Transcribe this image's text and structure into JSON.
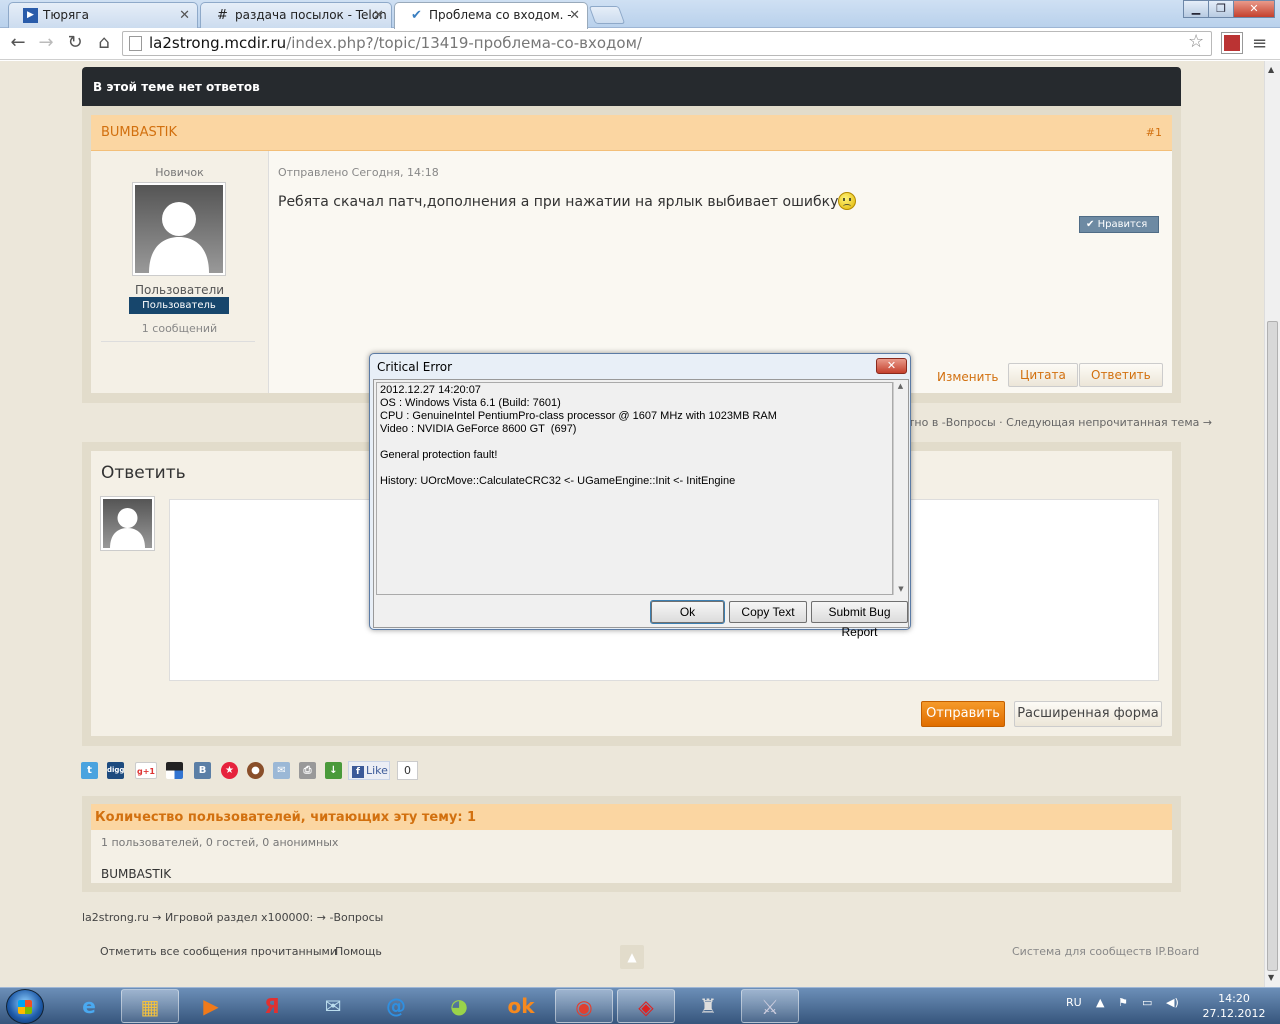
{
  "browser": {
    "tabs": [
      {
        "title": "Тюряга",
        "icon": "play-icon"
      },
      {
        "title": "раздача посылок - Telon",
        "icon": "hash-icon"
      },
      {
        "title": "Проблема со входом. - ",
        "icon": "check-icon"
      }
    ],
    "url_host": "la2strong.mcdir.ru",
    "url_path": "/index.php?/topic/13419-проблема-со-входом/"
  },
  "forum": {
    "no_replies": "В этой теме нет ответов",
    "post": {
      "author": "BUMBASTIK",
      "number": "#1",
      "rank": "Новичок",
      "group": "Пользователи",
      "group_badge": "Пользователь",
      "post_count": "1 сообщений",
      "posted": "Отправлено Сегодня, 14:18",
      "message": "Ребята скачал патч,дополнения а при нажатии на ярлык выбивает ошибку",
      "like": "Нравится",
      "edit": "Изменить",
      "quote": "Цитата",
      "reply": "Ответить"
    },
    "topic_nav": "тно в -Вопросы · Следующая непрочитанная тема →",
    "reply_box": {
      "title": "Ответить",
      "send": "Отправить",
      "advanced": "Расширенная форма"
    },
    "share": {
      "fb_like": "Like",
      "fb_count": "0"
    },
    "viewers": {
      "title": "Количество пользователей, читающих эту тему: 1",
      "counts": "1 пользователей, 0 гостей, 0 анонимных",
      "names": "BUMBASTIK"
    },
    "breadcrumb": "la2strong.ru  →  Игровой раздел x100000:  →  -Вопросы",
    "footer": {
      "mark_read": "Отметить все сообщения прочитанными",
      "help": "Помощь",
      "powered": "Система для сообществ IP.Board"
    }
  },
  "dialog": {
    "title": "Critical Error",
    "text": "2012.12.27 14:20:07\nOS : Windows Vista 6.1 (Build: 7601)\nCPU : GenuineIntel PentiumPro-class processor @ 1607 MHz with 1023MB RAM\nVideo : NVIDIA GeForce 8600 GT  (697)\n\nGeneral protection fault!\n\nHistory: UOrcMove::CalculateCRC32 <- UGameEngine::Init <- InitEngine",
    "ok": "Ok",
    "copy": "Copy Text",
    "submit": "Submit Bug Report"
  },
  "taskbar": {
    "lang": "RU",
    "time": "14:20",
    "date": "27.12.2012"
  },
  "colors": {
    "accent": "#d2700f",
    "header_bar": "#262a2e",
    "send_button": "#f0860f"
  }
}
